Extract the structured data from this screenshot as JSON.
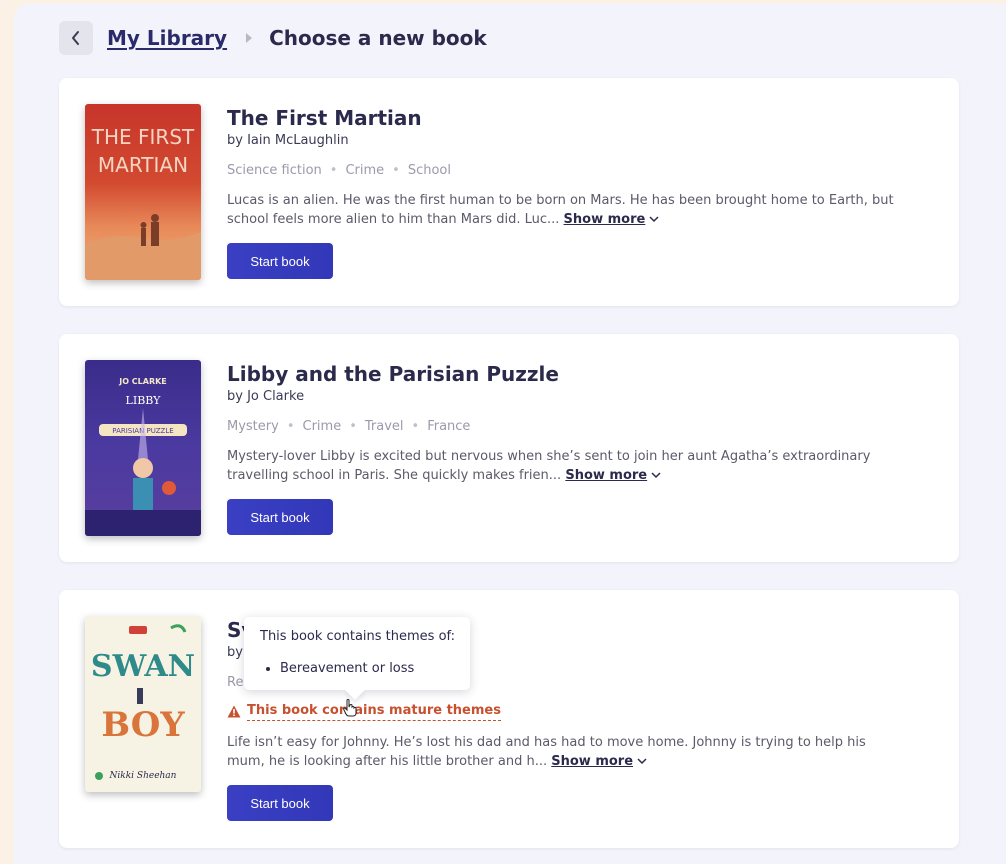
{
  "header": {
    "breadcrumb_link": "My Library",
    "page_title": "Choose a new book"
  },
  "books": [
    {
      "title": "The First Martian",
      "author": "by Iain McLaughlin",
      "genres": [
        "Science fiction",
        "Crime",
        "School"
      ],
      "description": "Lucas is an alien. He was the first human to be born on Mars. He has been brought home to Earth, but school feels more alien to him than Mars did. Luc...",
      "show_more": "Show more",
      "button": "Start book",
      "cover_text": [
        "THE FIRST",
        "MARTIAN"
      ]
    },
    {
      "title": "Libby and the Parisian Puzzle",
      "author": "by Jo Clarke",
      "genres": [
        "Mystery",
        "Crime",
        "Travel",
        "France"
      ],
      "description": "Mystery-lover Libby is excited but nervous when she’s sent to join her aunt Agatha’s extraordinary travelling school in Paris. She quickly makes frien...",
      "show_more": "Show more",
      "button": "Start book",
      "cover_text": [
        "JO CLARKE",
        "LIBBY",
        "PARISIAN PUZZLE"
      ]
    },
    {
      "title_visible": "Sv",
      "author_visible": "by",
      "genre_visible": "Re",
      "warning": "This book contains mature themes",
      "description": "Life isn’t easy for Johnny. He’s lost his dad and has had to move home. Johnny is trying to help his mum, he is looking after his little brother and h...",
      "show_more": "Show more",
      "button": "Start book",
      "cover_text": [
        "SWAN",
        "BOY",
        "Nikki Sheehan"
      ]
    }
  ],
  "tooltip": {
    "title": "This book contains themes of:",
    "items": [
      "Bereavement or loss"
    ]
  },
  "colors": {
    "accent": "#3a3fc4",
    "warning": "#c7512f",
    "background": "#f3f4fb"
  }
}
